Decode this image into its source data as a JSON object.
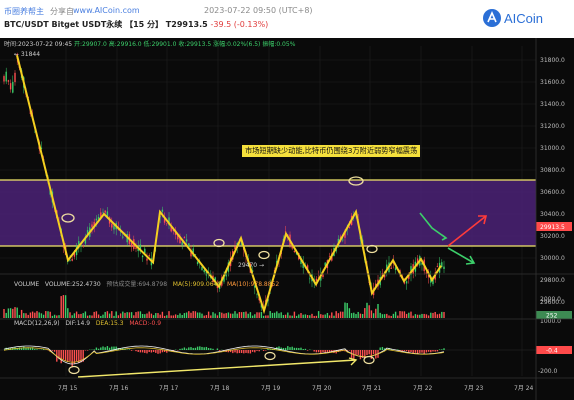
{
  "header": {
    "links": [
      "币圈养帮主",
      "分享自",
      "www.AICoin.com"
    ],
    "timestamp": "2023-07-22 09:50 (UTC+8)",
    "pair": "BTC/USDT Bitget USDT永续",
    "interval": "【15 分】",
    "price": "T29913.5",
    "change": "-39.5 (-0.13%)",
    "logo_text": "AICoin"
  },
  "ohlc_bar": {
    "time": "时间:2023-07-22 09:45",
    "open": "开:29907.0",
    "high": "高:29916.0",
    "low": "低:29901.0",
    "close": "收:29913.5",
    "change": "涨幅:0.02%(6.5)",
    "amplitude": "振幅:0.05%"
  },
  "annotations": {
    "note": "市场短期缺少动能,比特币仍围绕3万附近弱势窄幅震荡",
    "high_label": "← 31844",
    "low_label": "29470 →"
  },
  "price_axis": {
    "ticks": [
      "31800.0",
      "31600.0",
      "31400.0",
      "31200.0",
      "31000.0",
      "30800.0",
      "30600.0",
      "30400.0",
      "30200.0",
      "30000.0",
      "29800.0",
      "29600.0"
    ],
    "current": "29913.5"
  },
  "volume_panel": {
    "label": "VOLUME",
    "volume": "VOLUME:252.4730",
    "forecast": "预估成交量:694.8798",
    "ma5": "MA(5):909.0640",
    "ma10": "MA(10):978.8852",
    "ticks": [
      "2000.0",
      "1000.0"
    ],
    "current": "252"
  },
  "macd_panel": {
    "label": "MACD(12,26,9)",
    "dif": "DIF:14.9",
    "dea": "DEA:15.3",
    "macd": "MACD:-0.9",
    "ticks": [
      "-200.0"
    ],
    "current": "-0.4"
  },
  "time_axis": {
    "ticks": [
      "7月 15",
      "7月 16",
      "7月 17",
      "7月 18",
      "7月 19",
      "7月 20",
      "7月 21",
      "7月 22",
      "7月 23",
      "7月 24"
    ]
  },
  "colors": {
    "background": "#0a0a0a",
    "zone": "#5a2a8a",
    "zone_line": "#f2e86a",
    "zigzag": "#f5d020",
    "up": "#3ccf6a",
    "down": "#ff5050",
    "macd_dif": "#f5f5f5",
    "macd_dea": "#e0c030"
  },
  "chart_data": {
    "type": "candlestick",
    "price_range": [
      29450,
      31900
    ],
    "resistance": 30420,
    "support": 29710,
    "zigzag_prices": [
      31844,
      29980,
      30400,
      29740,
      30420,
      29730,
      30180,
      29500,
      30140,
      29740,
      30420,
      29650,
      30000,
      29770,
      30000
    ],
    "projection": {
      "up_target": 30030,
      "down_target": 29560
    },
    "last_close": 29913.5
  }
}
